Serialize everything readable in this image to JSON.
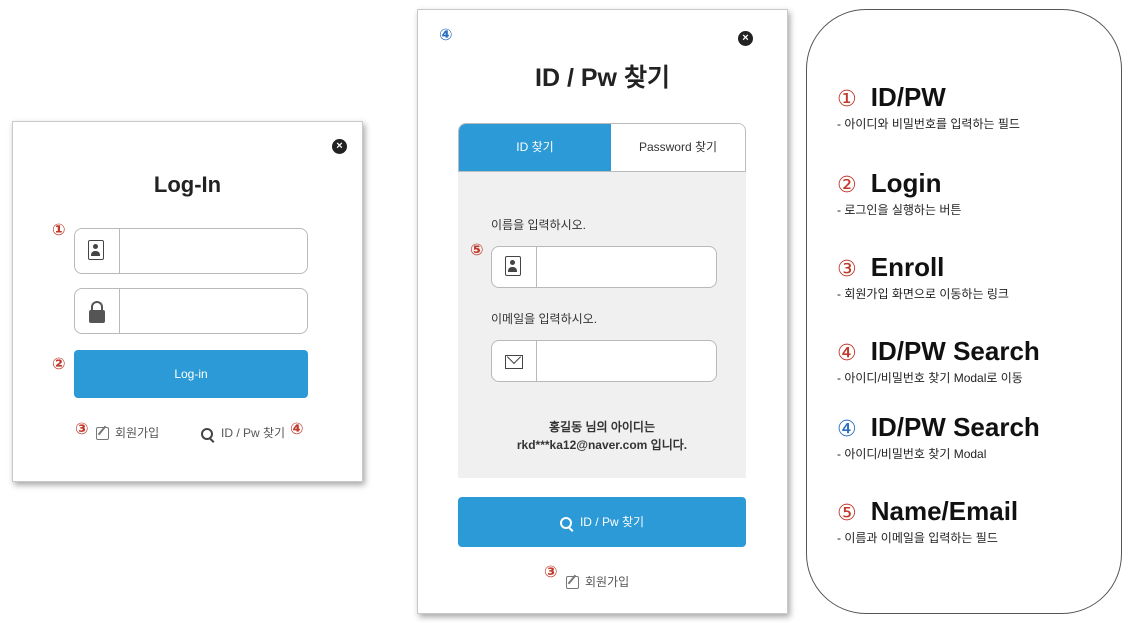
{
  "login": {
    "title": "Log-In",
    "close_label": "×",
    "login_button": "Log-in",
    "enroll_link": "회원가입",
    "search_link": "ID / Pw 찾기",
    "markers": {
      "idpw": "①",
      "login": "②",
      "enroll": "③",
      "search": "④"
    }
  },
  "search": {
    "title": "ID / Pw 찾기",
    "close_label": "×",
    "marker_modal": "④",
    "marker_fields": "⑤",
    "marker_enroll": "③",
    "tabs": [
      "ID 찾기",
      "Password 찾기"
    ],
    "name_label": "이름을 입력하시오.",
    "email_label": "이메일을 입력하시오.",
    "result_line1": "홍길동 님의 아이디는",
    "result_line2": "rkd***ka12@naver.com 입니다.",
    "search_button": "ID / Pw 찾기",
    "enroll_link": "회원가입"
  },
  "legend": {
    "items": [
      {
        "num": "①",
        "title": "ID/PW",
        "desc": "- 아이디와 비밀번호를 입력하는 필드",
        "color": "red"
      },
      {
        "num": "②",
        "title": "Login",
        "desc": "- 로그인을 실행하는 버튼",
        "color": "red"
      },
      {
        "num": "③",
        "title": "Enroll",
        "desc": "- 회원가입 화면으로 이동하는 링크",
        "color": "red"
      },
      {
        "num": "④",
        "title": "ID/PW Search",
        "desc": "- 아이디/비밀번호 찾기 Modal로 이동",
        "color": "red"
      },
      {
        "num": "④",
        "title": "ID/PW Search",
        "desc": "- 아이디/비밀번호 찾기 Modal",
        "color": "blue"
      },
      {
        "num": "⑤",
        "title": "Name/Email",
        "desc": "- 이름과 이메일을 입력하는 필드",
        "color": "red"
      }
    ]
  },
  "colors": {
    "primary": "#2b9ad6",
    "marker_red": "#c0392b",
    "marker_blue": "#2b6ec0"
  },
  "icons": [
    "close-icon",
    "id-card-icon",
    "lock-icon",
    "pencil-icon",
    "search-icon",
    "mail-icon"
  ]
}
